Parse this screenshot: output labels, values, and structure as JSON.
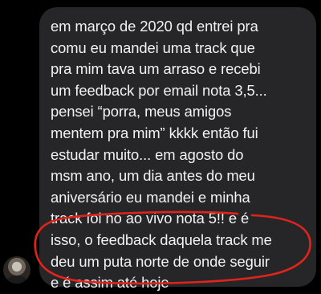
{
  "message": {
    "sender_avatar_icon": "user-avatar-photo",
    "lines": [
      "em março de 2020 qd entrei pra",
      "comu eu mandei uma track que",
      "pra mim tava um arraso e recebi",
      "um feedback por email nota 3,5...",
      "pensei “porra, meus amigos",
      "mentem pra mim” kkkk então fui",
      "estudar muito... em agosto do",
      "msm ano, um dia antes do meu",
      "aniversário eu mandei e minha",
      "track foi no ao vivo nota 5!! e é",
      "isso, o feedback daquela track me",
      "deu um puta norte de onde seguir",
      "e é assim até hoje"
    ]
  },
  "annotation": {
    "circle_color": "#e0241b"
  },
  "colors": {
    "background": "#000000",
    "bubble": "#262628",
    "text": "#f2f2f2"
  }
}
